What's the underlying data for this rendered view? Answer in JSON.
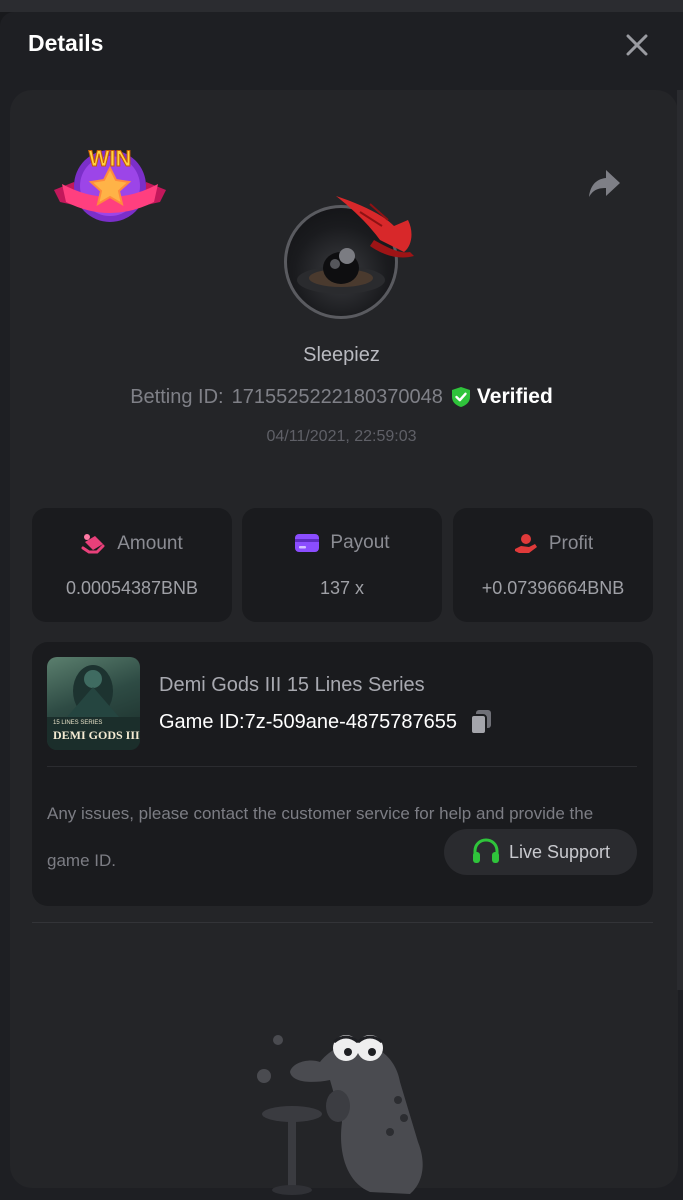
{
  "header": {
    "title": "Details"
  },
  "user": {
    "name": "Sleepiez",
    "betting_id_label": "Betting ID:",
    "betting_id": "1715525222180370048",
    "verified_label": "Verified",
    "timestamp": "04/11/2021, 22:59:03"
  },
  "badge": {
    "text": "WIN"
  },
  "stats": [
    {
      "label": "Amount",
      "value": "0.00054387BNB",
      "icon": "coins-icon",
      "icon_color": "#e8407a"
    },
    {
      "label": "Payout",
      "value": "137 x",
      "icon": "wallet-icon",
      "icon_color": "#8b4dff"
    },
    {
      "label": "Profit",
      "value": "+0.07396664BNB",
      "icon": "hand-profit-icon",
      "icon_color": "#e03a3a"
    }
  ],
  "game": {
    "name": "Demi Gods III 15 Lines Series",
    "id_label": "Game ID:",
    "id": "7z-509ane-4875787655",
    "thumb_series": "15 LINES SERIES",
    "thumb_title": "DEMI GODS III"
  },
  "support": {
    "help_text": "Any issues, please contact the customer service for help and provide the game ID.",
    "button_label": "Live Support"
  },
  "colors": {
    "accent_green": "#2fc43b",
    "background": "#18191c",
    "panel": "#242528",
    "card": "#1a1b1e"
  }
}
